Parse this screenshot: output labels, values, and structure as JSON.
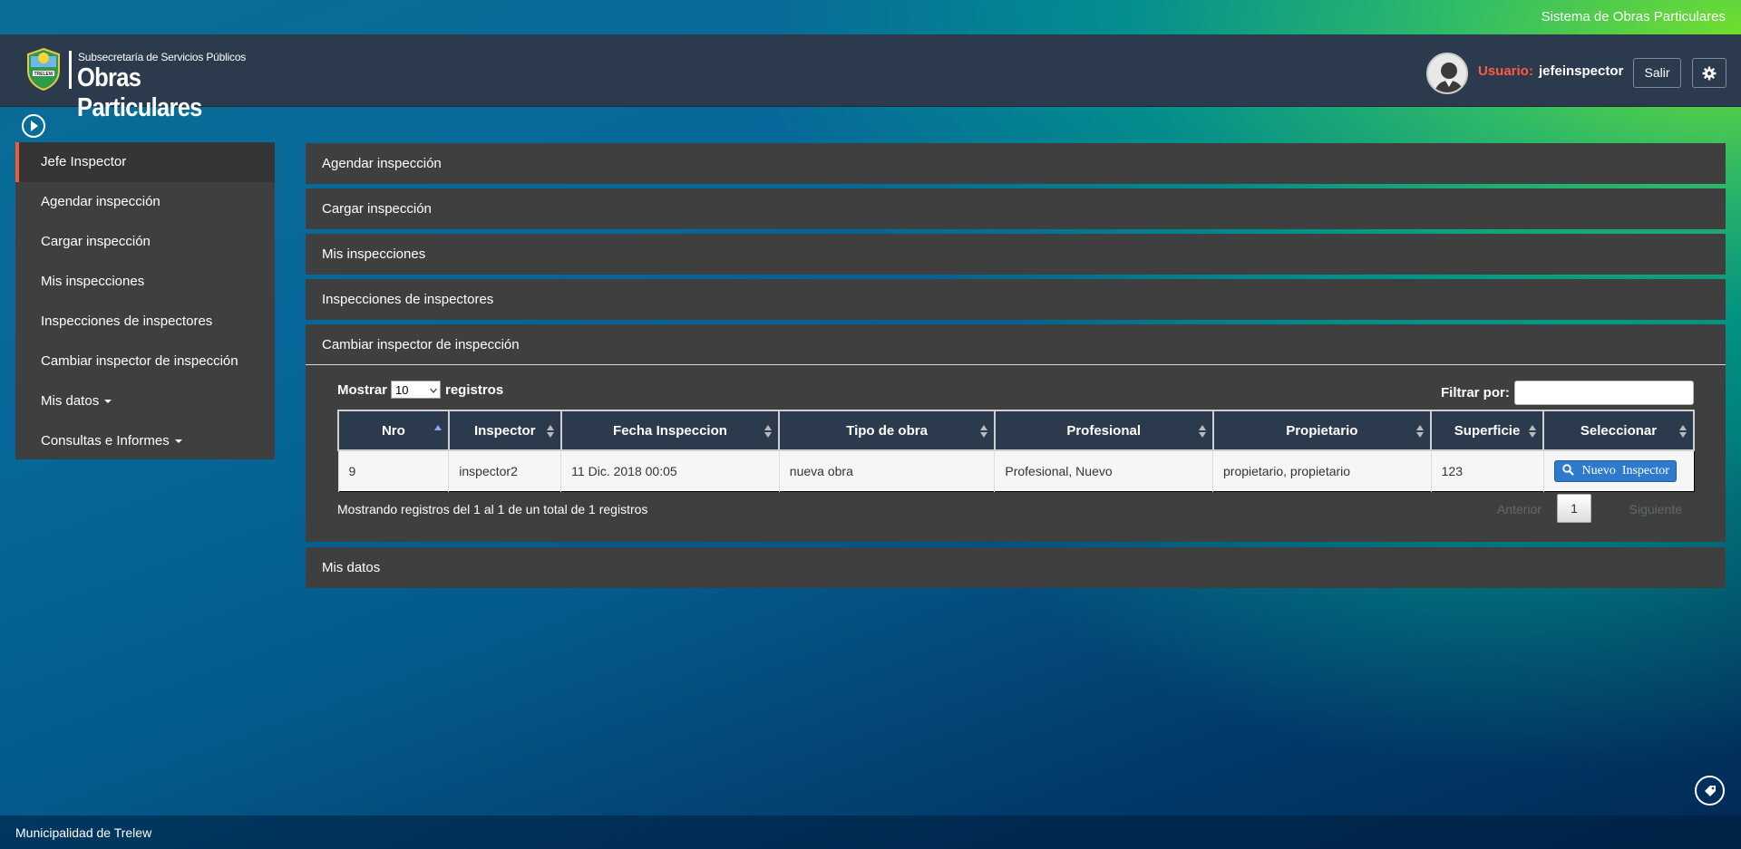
{
  "top_bar": {
    "system_title": "Sistema de Obras Particulares"
  },
  "header": {
    "logo": {
      "subtitle": "Subsecretaría de Servicios Públicos",
      "title": "Obras Particulares",
      "shield_text": "TRELEW"
    },
    "user_label": "Usuario:",
    "username": "jefeinspector",
    "logout_label": "Salir",
    "settings_icon": "gear-icon"
  },
  "sidebar": {
    "items": [
      {
        "label": "Jefe Inspector",
        "active": true
      },
      {
        "label": "Agendar inspección"
      },
      {
        "label": "Cargar inspección"
      },
      {
        "label": "Mis inspecciones"
      },
      {
        "label": "Inspecciones de inspectores"
      },
      {
        "label": "Cambiar inspector de inspección"
      },
      {
        "label": "Mis datos",
        "dropdown": true
      },
      {
        "label": "Consultas e Informes",
        "dropdown": true
      }
    ]
  },
  "panels": [
    {
      "title": "Agendar inspección"
    },
    {
      "title": "Cargar inspección"
    },
    {
      "title": "Mis inspecciones"
    },
    {
      "title": "Inspecciones de inspectores"
    },
    {
      "title": "Cambiar inspector de inspección",
      "expanded": true
    },
    {
      "title": "Mis datos"
    }
  ],
  "datatable": {
    "length_label_pre": "Mostrar",
    "length_value": "10",
    "length_label_post": "registros",
    "filter_label": "Filtrar por:",
    "filter_value": "",
    "columns": [
      "Nro",
      "Inspector",
      "Fecha Inspeccion",
      "Tipo de obra",
      "Profesional",
      "Propietario",
      "Superficie",
      "Seleccionar"
    ],
    "rows": [
      {
        "nro": "9",
        "inspector": "inspector2",
        "fecha": "11 Dic. 2018 00:05",
        "tipo": "nueva obra",
        "profesional": "Profesional, Nuevo",
        "propietario": "propietario, propietario",
        "superficie": "123",
        "action_label": "Nuevo  Inspector"
      }
    ],
    "info": "Mostrando registros del 1 al 1 de un total de 1 registros",
    "pagination": {
      "prev": "Anterior",
      "current": "1",
      "next": "Siguiente"
    }
  },
  "footer": {
    "text": "Municipalidad de Trelew"
  },
  "colors": {
    "header_bg": "#2b3a4d",
    "panel_bg": "#3f3f40",
    "active_accent": "#f15a3a",
    "user_label": "#ff5a45",
    "action_button": "#2e7bcd"
  }
}
